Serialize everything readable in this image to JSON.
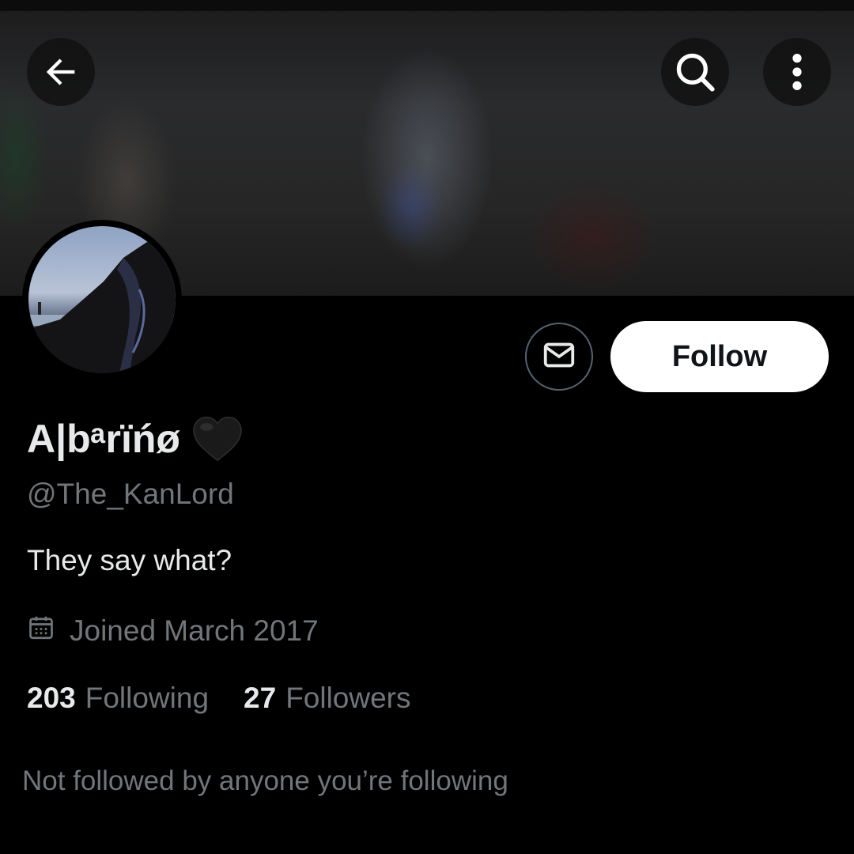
{
  "header": {
    "back_icon": "arrow-left-icon",
    "search_icon": "search-icon",
    "more_icon": "more-vertical-icon"
  },
  "profile": {
    "display_name": "A|bᵃrïńø",
    "name_emoji": "black-heart-icon",
    "handle": "@The_KanLord",
    "bio": "They say what?",
    "joined": "Joined March 2017",
    "following_count": "203",
    "following_label": "Following",
    "followers_count": "27",
    "followers_label": "Followers",
    "mutuals_note": "Not followed by anyone you’re following"
  },
  "actions": {
    "message_icon": "envelope-icon",
    "follow_label": "Follow"
  },
  "colors": {
    "background": "#000000",
    "primary_text": "#e7e9ea",
    "secondary_text": "#71767b",
    "follow_button_bg": "#ffffff",
    "follow_button_text": "#0f1419",
    "outline": "#536471"
  }
}
